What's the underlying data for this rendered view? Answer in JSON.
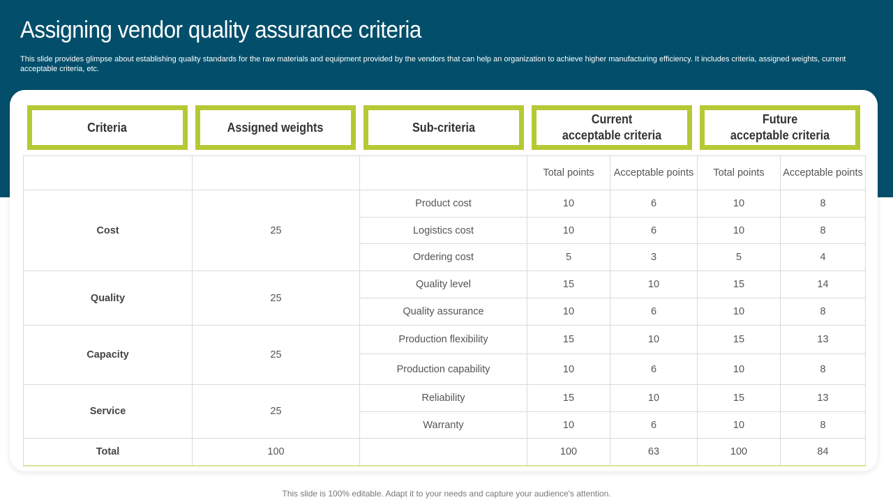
{
  "header": {
    "title": "Assigning vendor quality assurance criteria",
    "description": "This slide provides glimpse about establishing quality standards for the raw materials and equipment provided by the vendors that can help an organization to achieve higher manufacturing efficiency. It includes criteria, assigned weights, current acceptable criteria, etc."
  },
  "column_headers": {
    "criteria": "Criteria",
    "weights": "Assigned weights",
    "sub_criteria": "Sub-criteria",
    "current": "Current\nacceptable criteria",
    "future": "Future\nacceptable criteria"
  },
  "subheaders": {
    "current_total": "Total points",
    "current_acceptable": "Acceptable points",
    "future_total": "Total points",
    "future_acceptable": "Acceptable points"
  },
  "groups": [
    {
      "criteria": "Cost",
      "weight": "25",
      "rows": [
        {
          "sub": "Product cost",
          "cur_total": "10",
          "cur_acc": "6",
          "fut_total": "10",
          "fut_acc": "8"
        },
        {
          "sub": "Logistics cost",
          "cur_total": "10",
          "cur_acc": "6",
          "fut_total": "10",
          "fut_acc": "8"
        },
        {
          "sub": "Ordering cost",
          "cur_total": "5",
          "cur_acc": "3",
          "fut_total": "5",
          "fut_acc": "4"
        }
      ]
    },
    {
      "criteria": "Quality",
      "weight": "25",
      "rows": [
        {
          "sub": "Quality level",
          "cur_total": "15",
          "cur_acc": "10",
          "fut_total": "15",
          "fut_acc": "14"
        },
        {
          "sub": "Quality assurance",
          "cur_total": "10",
          "cur_acc": "6",
          "fut_total": "10",
          "fut_acc": "8"
        }
      ]
    },
    {
      "criteria": "Capacity",
      "weight": "25",
      "rows": [
        {
          "sub": "Production flexibility",
          "cur_total": "15",
          "cur_acc": "10",
          "fut_total": "15",
          "fut_acc": "13"
        },
        {
          "sub": "Production capability",
          "cur_total": "10",
          "cur_acc": "6",
          "fut_total": "10",
          "fut_acc": "8"
        }
      ]
    },
    {
      "criteria": "Service",
      "weight": "25",
      "rows": [
        {
          "sub": "Reliability",
          "cur_total": "15",
          "cur_acc": "10",
          "fut_total": "15",
          "fut_acc": "13"
        },
        {
          "sub": "Warranty",
          "cur_total": "10",
          "cur_acc": "6",
          "fut_total": "10",
          "fut_acc": "8"
        }
      ]
    }
  ],
  "total": {
    "label": "Total",
    "weight": "100",
    "sub": "",
    "cur_total": "100",
    "cur_acc": "63",
    "fut_total": "100",
    "fut_acc": "84"
  },
  "footer": "This slide is 100% editable. Adapt it to your needs and capture your audience's attention.",
  "colors": {
    "banner": "#034f6b",
    "accent": "#b5c935"
  }
}
